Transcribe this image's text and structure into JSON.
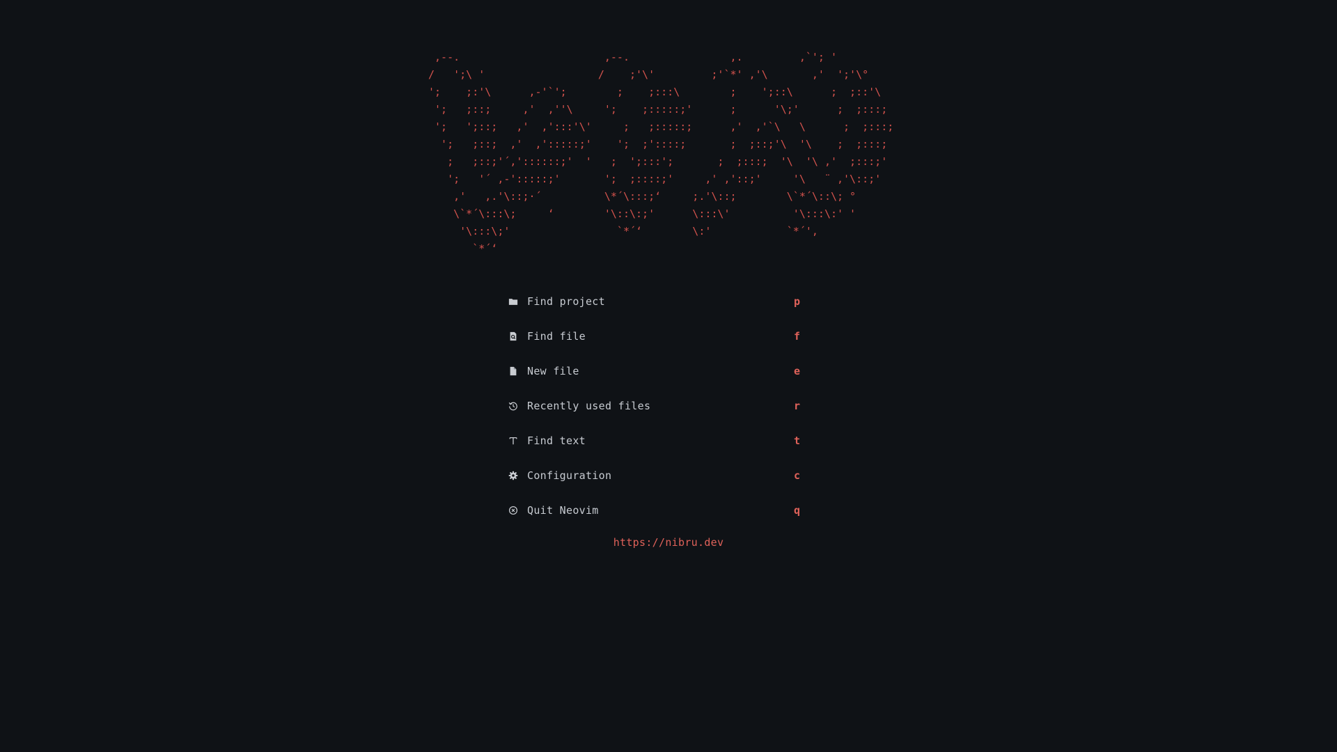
{
  "theme": {
    "background": "#0f1216",
    "accent": "#e0625a",
    "banner_color": "#d4534d",
    "text": "#c7cbd1"
  },
  "banner": {
    "ascii_art": " ,--.                       ,--.                ,.         ,`'; '\n/   ';\\ '                  /    ;'\\'         ;'`*' ,'\\       ,'  ';'\\°\n';    ;:'\\      ,-'`';        ;    ;:::\\        ;    ';::\\      ;  ;::'\\\n ';   ;::;     ,'  ,''\\     ';    ;:::::;'      ;      '\\;'      ;  ;:::;\n ';   ';::;   ,'  ,':::'\\'     ;   ;:::::;      ,'  ,'`\\   \\      ;  ;:::;\n  ';   ;::;  ,'  ,':::::;'    ';  ;'::::;       ;  ;::;'\\  '\\    ;  ;:::;\n   ;   ;::;'´,'::::::;'  '   ;  ';:::';       ;  ;:::;  '\\  '\\ ,'  ;:::;'\n   ';   '´ ,-':::::;'       ';  ;::::;'     ,' ,'::;'     '\\   ¨ ,'\\::;'\n    ,'   ,.'\\::;·´          \\*´\\:::;‘     ;.'\\::;        \\`*´\\::\\; °\n    \\`*´\\:::\\;     ‘        '\\::\\:;'      \\:::\\'          '\\:::\\:' '\n     '\\:::\\;'                 `*´‘        \\:'            `*´',\n       `*´‘"
  },
  "menu": [
    {
      "icon": "folder-icon",
      "label": "Find project",
      "key": "p"
    },
    {
      "icon": "file-search-icon",
      "label": "Find file",
      "key": "f"
    },
    {
      "icon": "new-file-icon",
      "label": "New file",
      "key": "e"
    },
    {
      "icon": "history-icon",
      "label": "Recently used files",
      "key": "r"
    },
    {
      "icon": "text-icon",
      "label": "Find text",
      "key": "t"
    },
    {
      "icon": "gear-icon",
      "label": "Configuration",
      "key": "c"
    },
    {
      "icon": "close-circle-icon",
      "label": "Quit Neovim",
      "key": "q"
    }
  ],
  "footer": {
    "url": "https://nibru.dev"
  }
}
